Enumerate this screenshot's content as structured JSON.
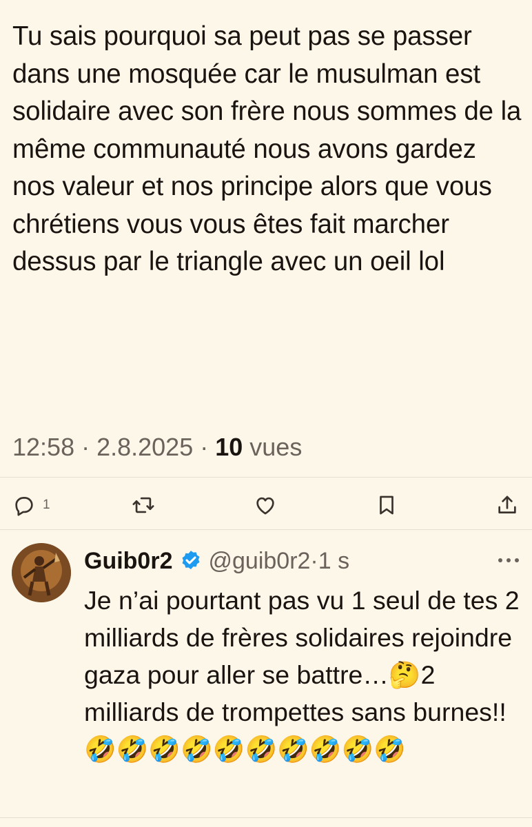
{
  "tweet": {
    "text": "Tu sais pourquoi sa peut pas se passer dans une mosquée car le musulman est solidaire avec son frère nous sommes de la même communauté nous avons gardez nos valeur et nos principe alors que vous chrétiens vous vous êtes fait marcher dessus par le triangle avec un oeil lol",
    "time": "12:58",
    "sep1": " · ",
    "date": "2.8.2025",
    "sep2": " · ",
    "views_count": "10",
    "views_label": " vues"
  },
  "actions": {
    "reply_count": "1",
    "icons": [
      "reply-icon",
      "retweet-icon",
      "like-icon",
      "bookmark-icon",
      "share-icon"
    ]
  },
  "reply": {
    "name": "Guib0r2",
    "handle": "@guib0r2",
    "sep": " · ",
    "time": "1 s",
    "text": "Je n’ai pourtant pas vu 1 seul de tes 2 milliards de frères solidaires rejoindre gaza pour aller se battre…🤔2 milliards de trompettes sans burnes!!🤣🤣🤣🤣🤣🤣🤣🤣🤣🤣"
  },
  "colors": {
    "background": "#fdf7ea",
    "text": "#1a1411",
    "muted": "#6b625b",
    "verified": "#1d9bf0"
  }
}
